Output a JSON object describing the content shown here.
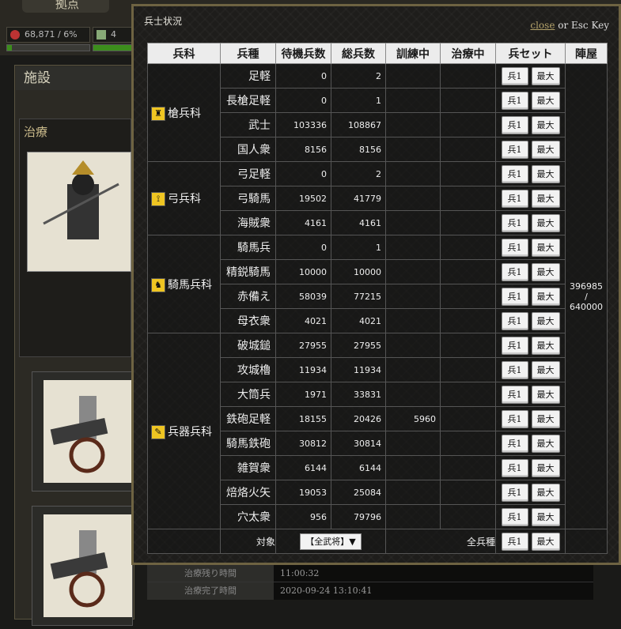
{
  "background": {
    "tab_label": "拠点",
    "resource_1": "68,871 / 6%",
    "resource_2": "4",
    "resource_1_level": 0.06,
    "section_title": "施設",
    "sub_title": "治療",
    "info_rows": [
      {
        "label": "治療残り時間",
        "value": "11:00:32"
      },
      {
        "label": "治療完了時間",
        "value": "2020-09-24 13:10:41"
      }
    ]
  },
  "modal": {
    "title": "兵士状況",
    "close_label": "close",
    "close_suffix": " or Esc Key",
    "headers": [
      "兵科",
      "兵種",
      "待機兵数",
      "総兵数",
      "訓練中",
      "治療中",
      "兵セット",
      "陣屋"
    ],
    "button_soldier": "兵1",
    "button_max": "最大",
    "barracks_current": "396985",
    "barracks_sep": "/",
    "barracks_max": "640000",
    "categories": [
      {
        "name": "槍兵科",
        "icon": "spear-icon",
        "units": [
          {
            "name": "足軽",
            "waiting": "0",
            "total": "2",
            "training": "",
            "healing": ""
          },
          {
            "name": "長槍足軽",
            "waiting": "0",
            "total": "1",
            "training": "",
            "healing": ""
          },
          {
            "name": "武士",
            "waiting": "103336",
            "total": "108867",
            "training": "",
            "healing": ""
          },
          {
            "name": "国人衆",
            "waiting": "8156",
            "total": "8156",
            "training": "",
            "healing": ""
          }
        ]
      },
      {
        "name": "弓兵科",
        "icon": "bow-icon",
        "units": [
          {
            "name": "弓足軽",
            "waiting": "0",
            "total": "2",
            "training": "",
            "healing": ""
          },
          {
            "name": "弓騎馬",
            "waiting": "19502",
            "total": "41779",
            "training": "",
            "healing": ""
          },
          {
            "name": "海賊衆",
            "waiting": "4161",
            "total": "4161",
            "training": "",
            "healing": ""
          }
        ]
      },
      {
        "name": "騎馬兵科",
        "icon": "horse-icon",
        "units": [
          {
            "name": "騎馬兵",
            "waiting": "0",
            "total": "1",
            "training": "",
            "healing": ""
          },
          {
            "name": "精鋭騎馬",
            "waiting": "10000",
            "total": "10000",
            "training": "",
            "healing": ""
          },
          {
            "name": "赤備え",
            "waiting": "58039",
            "total": "77215",
            "training": "",
            "healing": ""
          },
          {
            "name": "母衣衆",
            "waiting": "4021",
            "total": "4021",
            "training": "",
            "healing": ""
          }
        ]
      },
      {
        "name": "兵器兵科",
        "icon": "weapon-icon",
        "units": [
          {
            "name": "破城鎚",
            "waiting": "27955",
            "total": "27955",
            "training": "",
            "healing": ""
          },
          {
            "name": "攻城櫓",
            "waiting": "11934",
            "total": "11934",
            "training": "",
            "healing": ""
          },
          {
            "name": "大筒兵",
            "waiting": "1971",
            "total": "33831",
            "training": "",
            "healing": ""
          },
          {
            "name": "鉄砲足軽",
            "waiting": "18155",
            "total": "20426",
            "training": "5960",
            "healing": ""
          },
          {
            "name": "騎馬鉄砲",
            "waiting": "30812",
            "total": "30814",
            "training": "",
            "healing": ""
          },
          {
            "name": "雑賀衆",
            "waiting": "6144",
            "total": "6144",
            "training": "",
            "healing": ""
          },
          {
            "name": "焙烙火矢",
            "waiting": "19053",
            "total": "25084",
            "training": "",
            "healing": ""
          },
          {
            "name": "穴太衆",
            "waiting": "956",
            "total": "79796",
            "training": "",
            "healing": ""
          }
        ]
      }
    ],
    "footer": {
      "target_label": "対象",
      "target_select": "【全武将】▼",
      "all_types_label": "全兵種"
    }
  }
}
